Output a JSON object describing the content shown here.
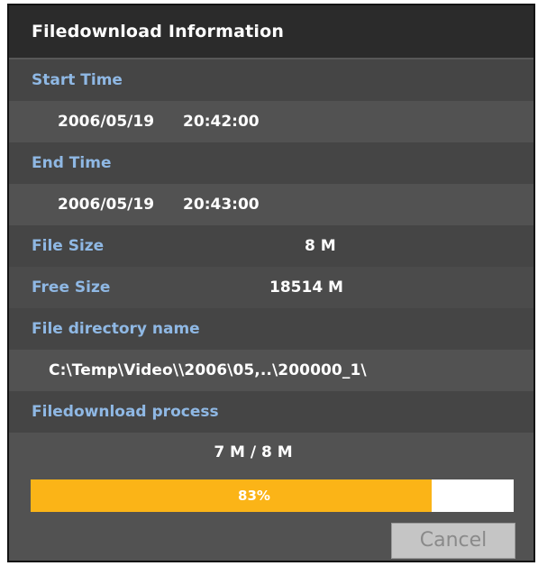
{
  "window": {
    "title": "Filedownload Information"
  },
  "start_time": {
    "label": "Start Time",
    "date": "2006/05/19",
    "time": "20:42:00"
  },
  "end_time": {
    "label": "End Time",
    "date": "2006/05/19",
    "time": "20:43:00"
  },
  "file_size": {
    "label": "File Size",
    "value": "8 M"
  },
  "free_size": {
    "label": "Free Size",
    "value": "18514 M"
  },
  "file_directory": {
    "label": "File directory name",
    "value": "C:\\Temp\\Video\\\\2006\\05,..\\200000_1\\"
  },
  "process": {
    "label": "Filedownload process",
    "status_text": "7 M / 8 M",
    "percent_label": "83%",
    "fraction": 0.83
  },
  "buttons": {
    "cancel": "Cancel"
  },
  "colors": {
    "label_text": "#8fb8e4",
    "progress_fill": "#fbb417",
    "window_bg": "#3e3e3e"
  }
}
